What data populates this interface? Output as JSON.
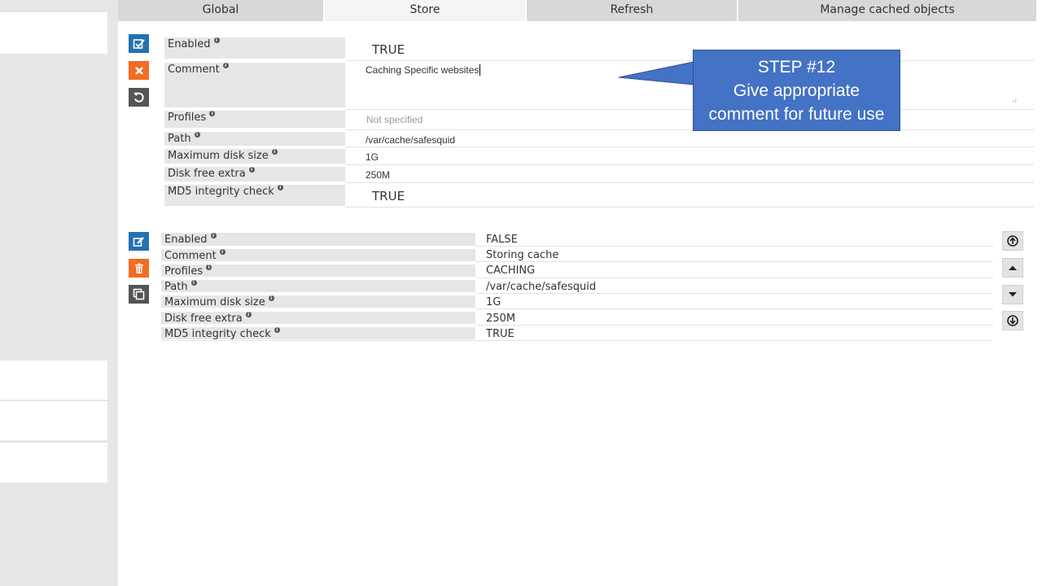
{
  "tabs": [
    {
      "label": "Global",
      "active": false
    },
    {
      "label": "Store",
      "active": true
    },
    {
      "label": "Refresh",
      "active": false
    },
    {
      "label": "Manage cached objects",
      "active": false
    }
  ],
  "edit_form": {
    "fields": {
      "enabled": {
        "label": "Enabled",
        "value": "TRUE"
      },
      "comment": {
        "label": "Comment",
        "value": "Caching Specific websites"
      },
      "profiles": {
        "label": "Profiles",
        "placeholder": "Not specified"
      },
      "path": {
        "label": "Path",
        "value": "/var/cache/safesquid"
      },
      "max_disk": {
        "label": "Maximum disk size",
        "value": "1G"
      },
      "disk_free": {
        "label": "Disk free extra",
        "value": "250M"
      },
      "md5": {
        "label": "MD5 integrity check",
        "value": "TRUE"
      }
    },
    "buttons": {
      "save_icon": "check-icon",
      "cancel_icon": "x-icon",
      "reset_icon": "undo-icon"
    }
  },
  "entry": {
    "fields": {
      "enabled": {
        "label": "Enabled",
        "value": "FALSE"
      },
      "comment": {
        "label": "Comment",
        "value": "Storing cache"
      },
      "profiles": {
        "label": "Profiles",
        "value": "CACHING"
      },
      "path": {
        "label": "Path",
        "value": "/var/cache/safesquid"
      },
      "max_disk": {
        "label": "Maximum disk size",
        "value": "1G"
      },
      "disk_free": {
        "label": "Disk free extra",
        "value": "250M"
      },
      "md5": {
        "label": "MD5 integrity check",
        "value": "TRUE"
      }
    },
    "buttons": {
      "edit_icon": "edit-icon",
      "delete_icon": "trash-icon",
      "duplicate_icon": "copy-icon"
    },
    "move_buttons": [
      "move-top-icon",
      "move-up-icon",
      "move-down-icon",
      "move-bottom-icon"
    ]
  },
  "callout": {
    "line1": "STEP #12",
    "line2": "Give appropriate",
    "line3": "comment for future use"
  },
  "colors": {
    "blue": "#2271b1",
    "orange": "#f26c22",
    "dark": "#555555",
    "callout": "#4472c4"
  }
}
